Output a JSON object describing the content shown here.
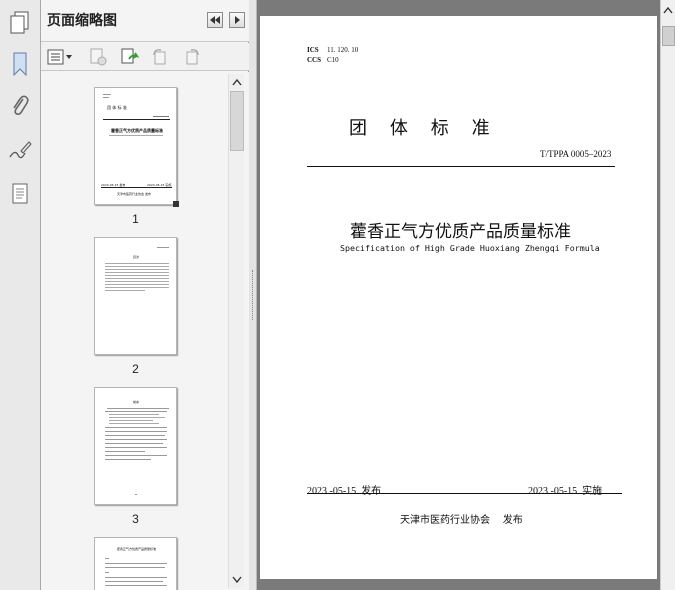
{
  "panel": {
    "title": "页面缩略图",
    "thumbnails": [
      {
        "label": "1"
      },
      {
        "label": "2"
      },
      {
        "label": "3"
      }
    ]
  },
  "icons": {
    "pages": "pages-icon",
    "bookmark": "bookmark-icon",
    "attachment": "paperclip-icon",
    "signature": "signature-pen-icon",
    "layers": "document-layers-icon",
    "options": "options-menu-icon",
    "delete": "delete-page-icon",
    "insert": "insert-page-icon",
    "rotate_left": "rotate-left-icon",
    "rotate_right": "rotate-right-icon"
  },
  "document": {
    "ics_label": "ICS",
    "ics_value": "11. 120. 10",
    "ccs_label": "CCS",
    "ccs_value": "C10",
    "header": "团    体    标    准",
    "standard_no": "T/TPPA 0005–2023",
    "title_cn": "藿香正气方优质产品质量标准",
    "title_en": "Specification of High Grade Huoxiang Zhengqi Formula",
    "issue_date": "2023 -05-15  发布",
    "implement_date": "2023 -05-15  实施",
    "publisher": "天津市医药行业协会    发布"
  },
  "thumb1": {
    "header": "团  体  标  准",
    "title": "藿香正气方优质产品质量标准",
    "date_left": "2023-05-15 发布",
    "date_right": "2023-05-15 实施",
    "publisher": "天津市医药行业协会 发布"
  },
  "thumb2": {
    "title": "目次"
  },
  "thumb3": {
    "title": "前言"
  },
  "thumb4": {
    "title": "藿香正气方优质产品质量标准"
  }
}
